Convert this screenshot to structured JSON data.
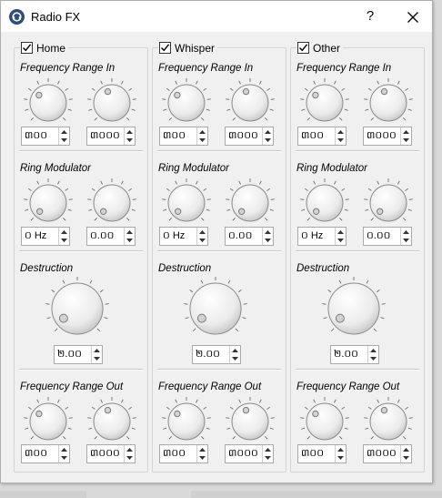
{
  "window": {
    "title": "Radio FX",
    "help_label": "?",
    "close_label": "✕"
  },
  "columns": [
    {
      "name": "Home",
      "checked": true,
      "freq_in": {
        "label": "Frequency Range In",
        "low": "៣០០",
        "high": "៣០០០"
      },
      "ring": {
        "label": "Ring Modulator",
        "freq": "០ Hz",
        "mix": "០.០០"
      },
      "destruction": {
        "label": "Destruction",
        "value": "២.០០"
      },
      "freq_out": {
        "label": "Frequency Range Out",
        "low": "៣០០",
        "high": "៣០០០"
      }
    },
    {
      "name": "Whisper",
      "checked": true,
      "freq_in": {
        "label": "Frequency Range In",
        "low": "៣០០",
        "high": "៣០០០"
      },
      "ring": {
        "label": "Ring Modulator",
        "freq": "០ Hz",
        "mix": "០.០០"
      },
      "destruction": {
        "label": "Destruction",
        "value": "២.០០"
      },
      "freq_out": {
        "label": "Frequency Range Out",
        "low": "៣០០",
        "high": "៣០០០"
      }
    },
    {
      "name": "Other",
      "checked": true,
      "freq_in": {
        "label": "Frequency Range In",
        "low": "៣០០",
        "high": "៣០០០"
      },
      "ring": {
        "label": "Ring Modulator",
        "freq": "០ Hz",
        "mix": "០.០០"
      },
      "destruction": {
        "label": "Destruction",
        "value": "២.០០"
      },
      "freq_out": {
        "label": "Frequency Range Out",
        "low": "៣០០",
        "high": "៣០០០"
      }
    }
  ],
  "colors": {
    "accent": "#2d4d7a",
    "panel": "#f0f0f0",
    "titlebar": "#ffffff"
  },
  "icons": {
    "app": "radio-fx-app-icon",
    "close": "close-icon",
    "help": "help-icon",
    "check": "check-icon",
    "spin_up": "arrow-up-icon",
    "spin_down": "arrow-down-icon"
  }
}
